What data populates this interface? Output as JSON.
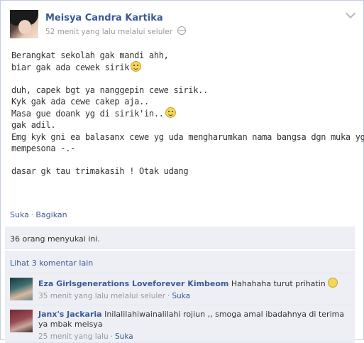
{
  "post": {
    "author": "Meisya Candra Kartika",
    "meta": "52 menit yang lalu melalui seluler",
    "privacy_icon": "globe-icon",
    "lines": [
      "Berangkat sekolah gak mandi ahh,",
      "biar gak ada cewek sirik",
      "",
      "duh, capek bgt ya nanggepin cewe sirik..",
      "Kyk gak ada cewe cakep aja..",
      "Masa gue doank yg di sirik'in..",
      "gak adil.",
      "Emg kyk gni ea balasanx cewe yg uda mengharumkan nama bangsa dgn muka yg",
      "mempesona -.-",
      "",
      "dasar gk tau trimakasih ! Otak udang"
    ]
  },
  "actions": {
    "like": "Suka",
    "share": "Bagikan"
  },
  "likes_text": "36 orang menyukai ini.",
  "view_comments": "Lihat 3 komentar lain",
  "comments": [
    {
      "author": "Eza Girlsgenerations Loveforever Kimbeom",
      "text": "Hahahaha turut prihatin",
      "time": "35 menit yang lalu melalui seluler",
      "like": "Suka"
    },
    {
      "author": "Janx's Jackaria",
      "text": "Inilalilahiwainalilahi rojiun ,, smoga amal ibadahnya di terima ya mbak meisya",
      "time": "25 menit yang lalu",
      "like": "Suka"
    }
  ],
  "colors": {
    "link": "#3b5998",
    "muted": "#999999",
    "ufi_bg": "#edeff4"
  }
}
